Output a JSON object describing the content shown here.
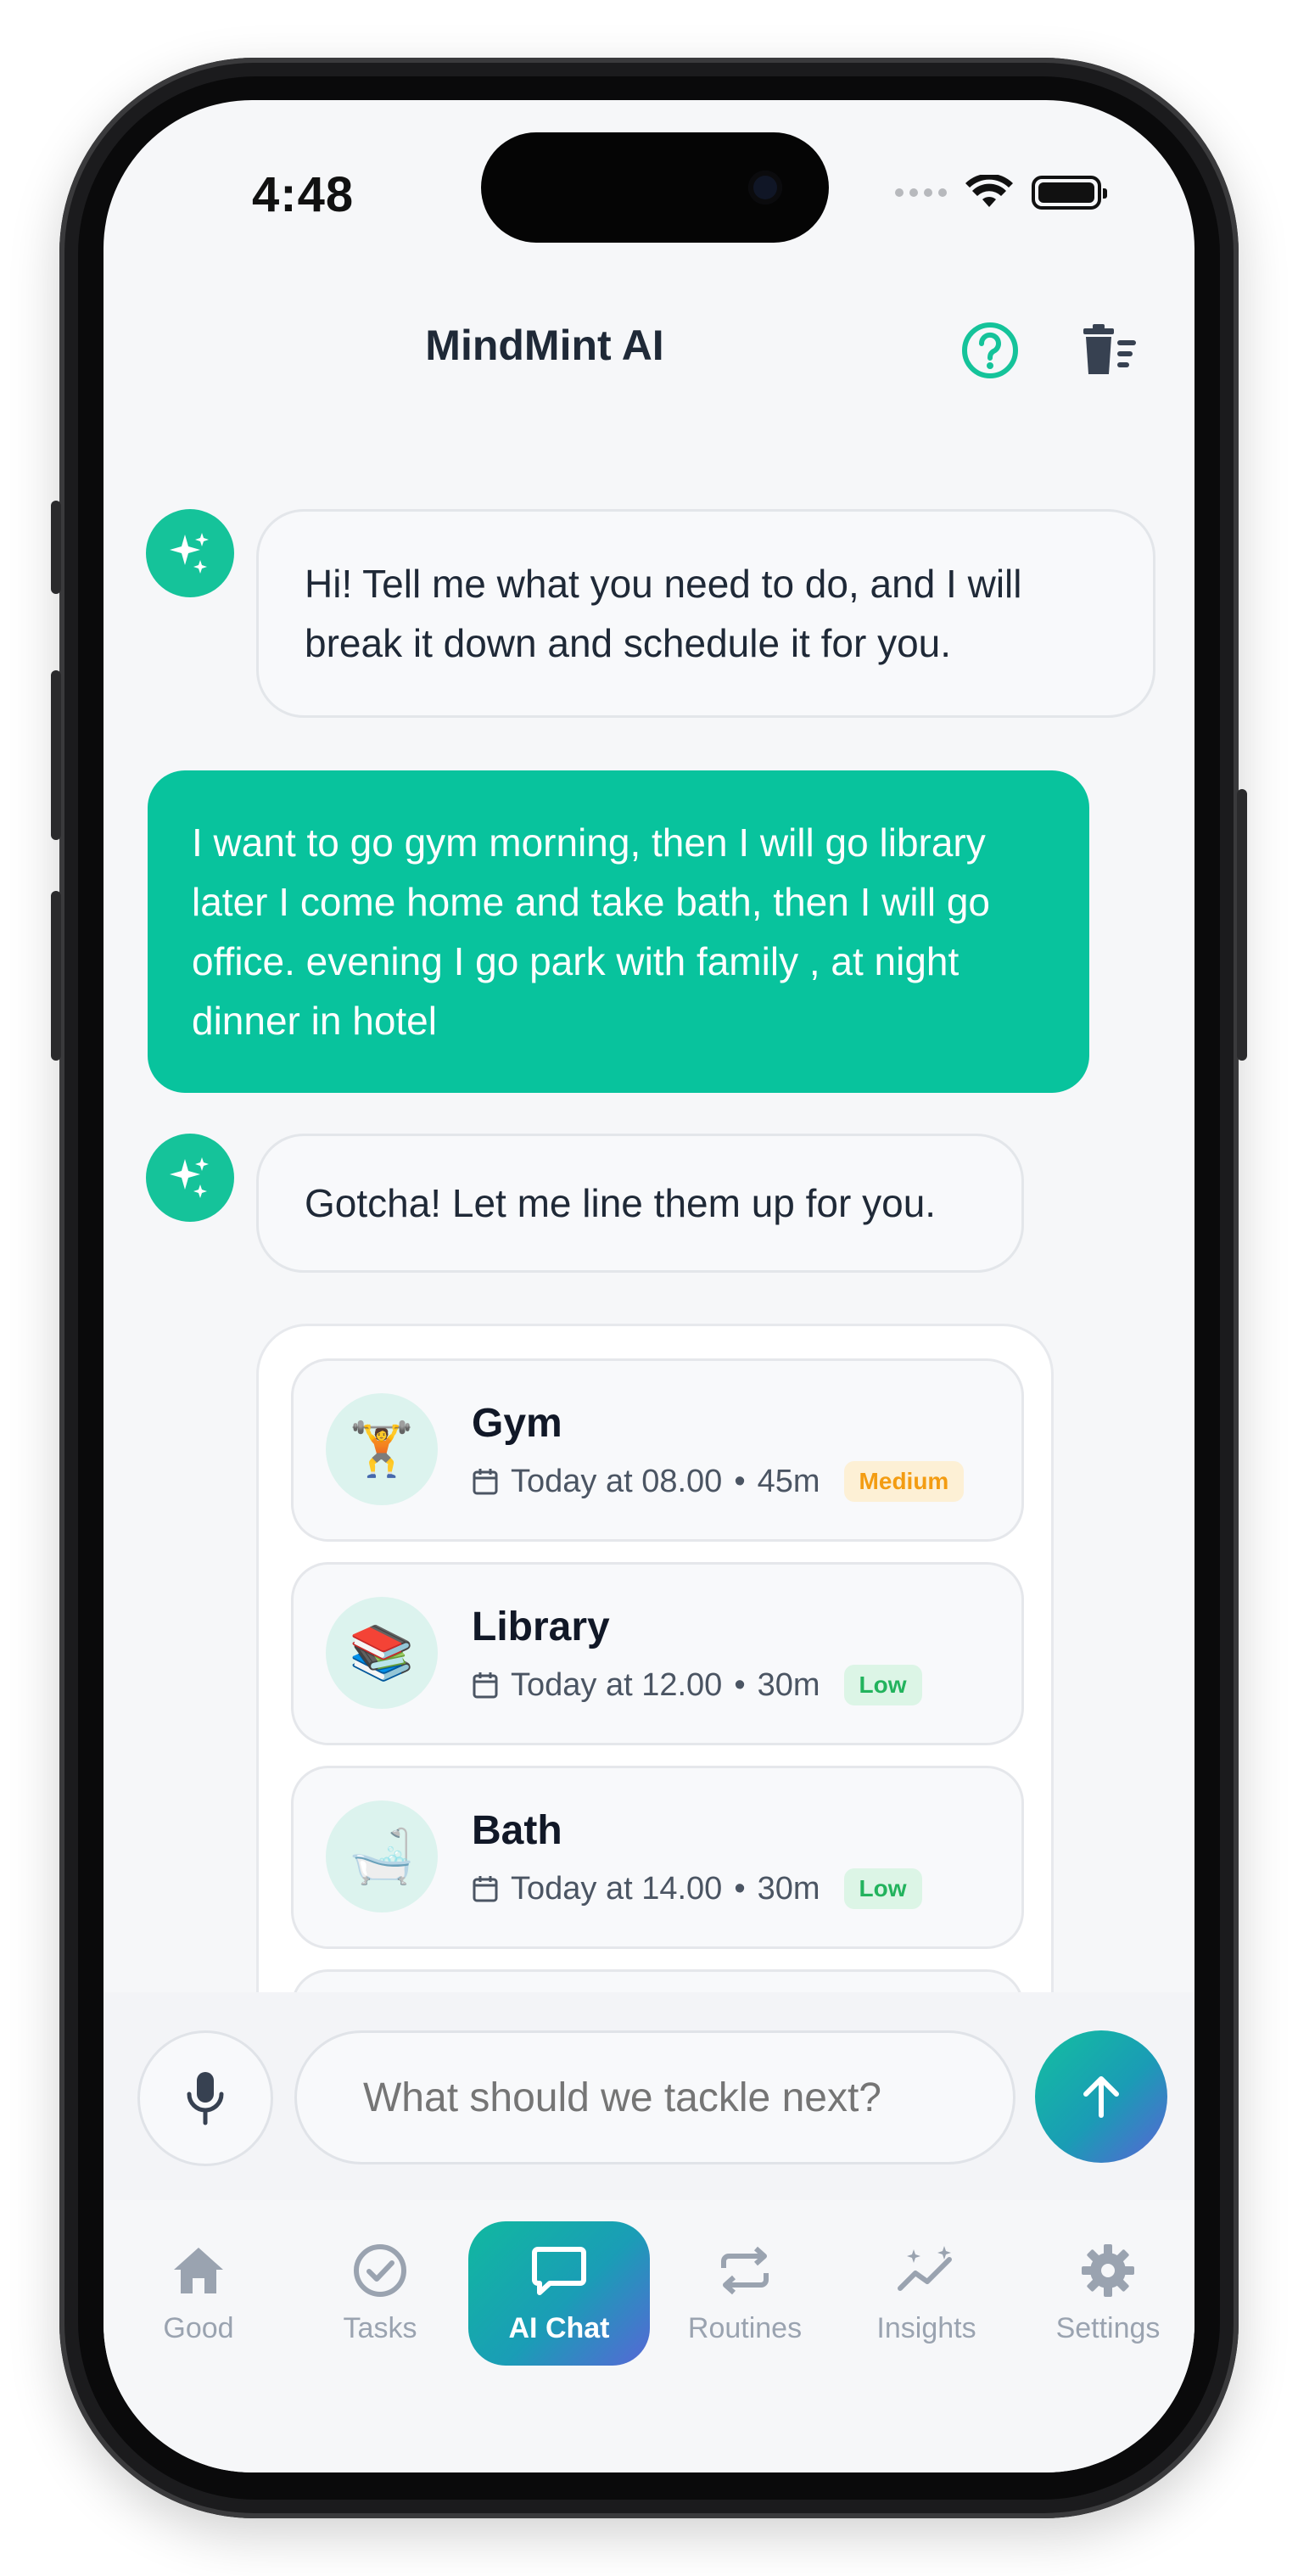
{
  "status_bar": {
    "time": "4:48"
  },
  "header": {
    "title": "MindMint AI"
  },
  "messages": [
    {
      "from": "ai",
      "text": "Hi! Tell me what you need to do, and I will break it down and schedule it for you."
    },
    {
      "from": "user",
      "text": "I want to go gym morning, then I will go library later I come home and take bath, then I will go office. evening I go park with family , at night dinner in hotel"
    },
    {
      "from": "ai",
      "text": "Gotcha! Let me line them up for you."
    }
  ],
  "tasks": [
    {
      "emoji": "🏋️",
      "name": "Gym",
      "time": "Today at 08.00",
      "duration": "45m",
      "priority": "Medium"
    },
    {
      "emoji": "📚",
      "name": "Library",
      "time": "Today at 12.00",
      "duration": "30m",
      "priority": "Low"
    },
    {
      "emoji": "🛁",
      "name": "Bath",
      "time": "Today at 14.00",
      "duration": "30m",
      "priority": "Low"
    }
  ],
  "composer": {
    "placeholder": "What should we tackle next?"
  },
  "nav": {
    "items": [
      {
        "label": "Good",
        "icon": "home-icon"
      },
      {
        "label": "Tasks",
        "icon": "check-circle-icon"
      },
      {
        "label": "AI Chat",
        "icon": "chat-icon",
        "active": true
      },
      {
        "label": "Routines",
        "icon": "repeat-icon"
      },
      {
        "label": "Insights",
        "icon": "insights-icon"
      },
      {
        "label": "Settings",
        "icon": "gear-icon"
      }
    ]
  },
  "colors": {
    "accent": "#08c39d",
    "medium": "#f39c12",
    "low": "#22b35d"
  }
}
